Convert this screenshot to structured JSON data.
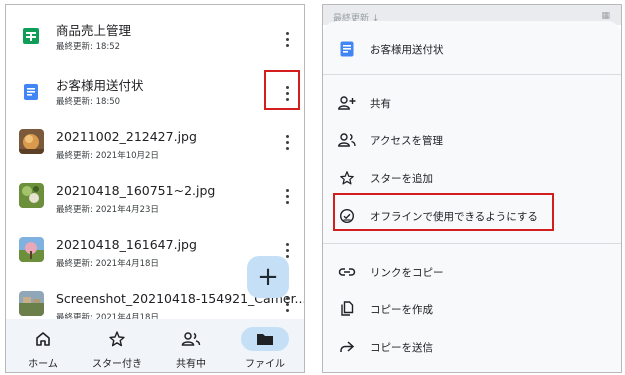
{
  "left": {
    "files": [
      {
        "name": "商品売上管理",
        "meta": "最終更新: 18:52",
        "icon": "sheets-icon"
      },
      {
        "name": "お客様用送付状",
        "meta": "最終更新: 18:50",
        "icon": "docs-icon"
      },
      {
        "name": "20211002_212427.jpg",
        "meta": "最終更新: 2021年10月2日",
        "icon": "image-thumbnail"
      },
      {
        "name": "20210418_160751~2.jpg",
        "meta": "最終更新: 2021年4月23日",
        "icon": "image-thumbnail"
      },
      {
        "name": "20210418_161647.jpg",
        "meta": "最終更新: 2021年4月18日",
        "icon": "image-thumbnail"
      },
      {
        "name": "Screenshot_20210418-154921_Camer...",
        "meta": "最終更新: 2021年4月18日",
        "icon": "image-thumbnail"
      }
    ],
    "fab_label": "+",
    "nav": [
      {
        "label": "ホーム",
        "icon": "home-icon"
      },
      {
        "label": "スター付き",
        "icon": "star-icon"
      },
      {
        "label": "共有中",
        "icon": "people-icon"
      },
      {
        "label": "ファイル",
        "icon": "folder-icon",
        "selected": true
      }
    ]
  },
  "right": {
    "peek_text": "最終更新 ↓",
    "peek_right": "▦",
    "title": "お客様用送付状",
    "menu": [
      {
        "label": "共有",
        "icon": "person-add-icon"
      },
      {
        "label": "アクセスを管理",
        "icon": "manage-access-icon"
      },
      {
        "label": "スターを追加",
        "icon": "star-outline-icon"
      },
      {
        "label": "オフラインで使用できるようにする",
        "icon": "offline-icon"
      },
      {
        "label": "リンクをコピー",
        "icon": "link-icon"
      },
      {
        "label": "コピーを作成",
        "icon": "copy-icon"
      },
      {
        "label": "コピーを送信",
        "icon": "send-icon"
      }
    ]
  },
  "colors": {
    "highlight": "#d41e1e",
    "docs_blue": "#4285f4",
    "sheets_green": "#0f9d58",
    "fab_bg": "#c5e0f6",
    "nav_selected": "#c5e0f6"
  }
}
